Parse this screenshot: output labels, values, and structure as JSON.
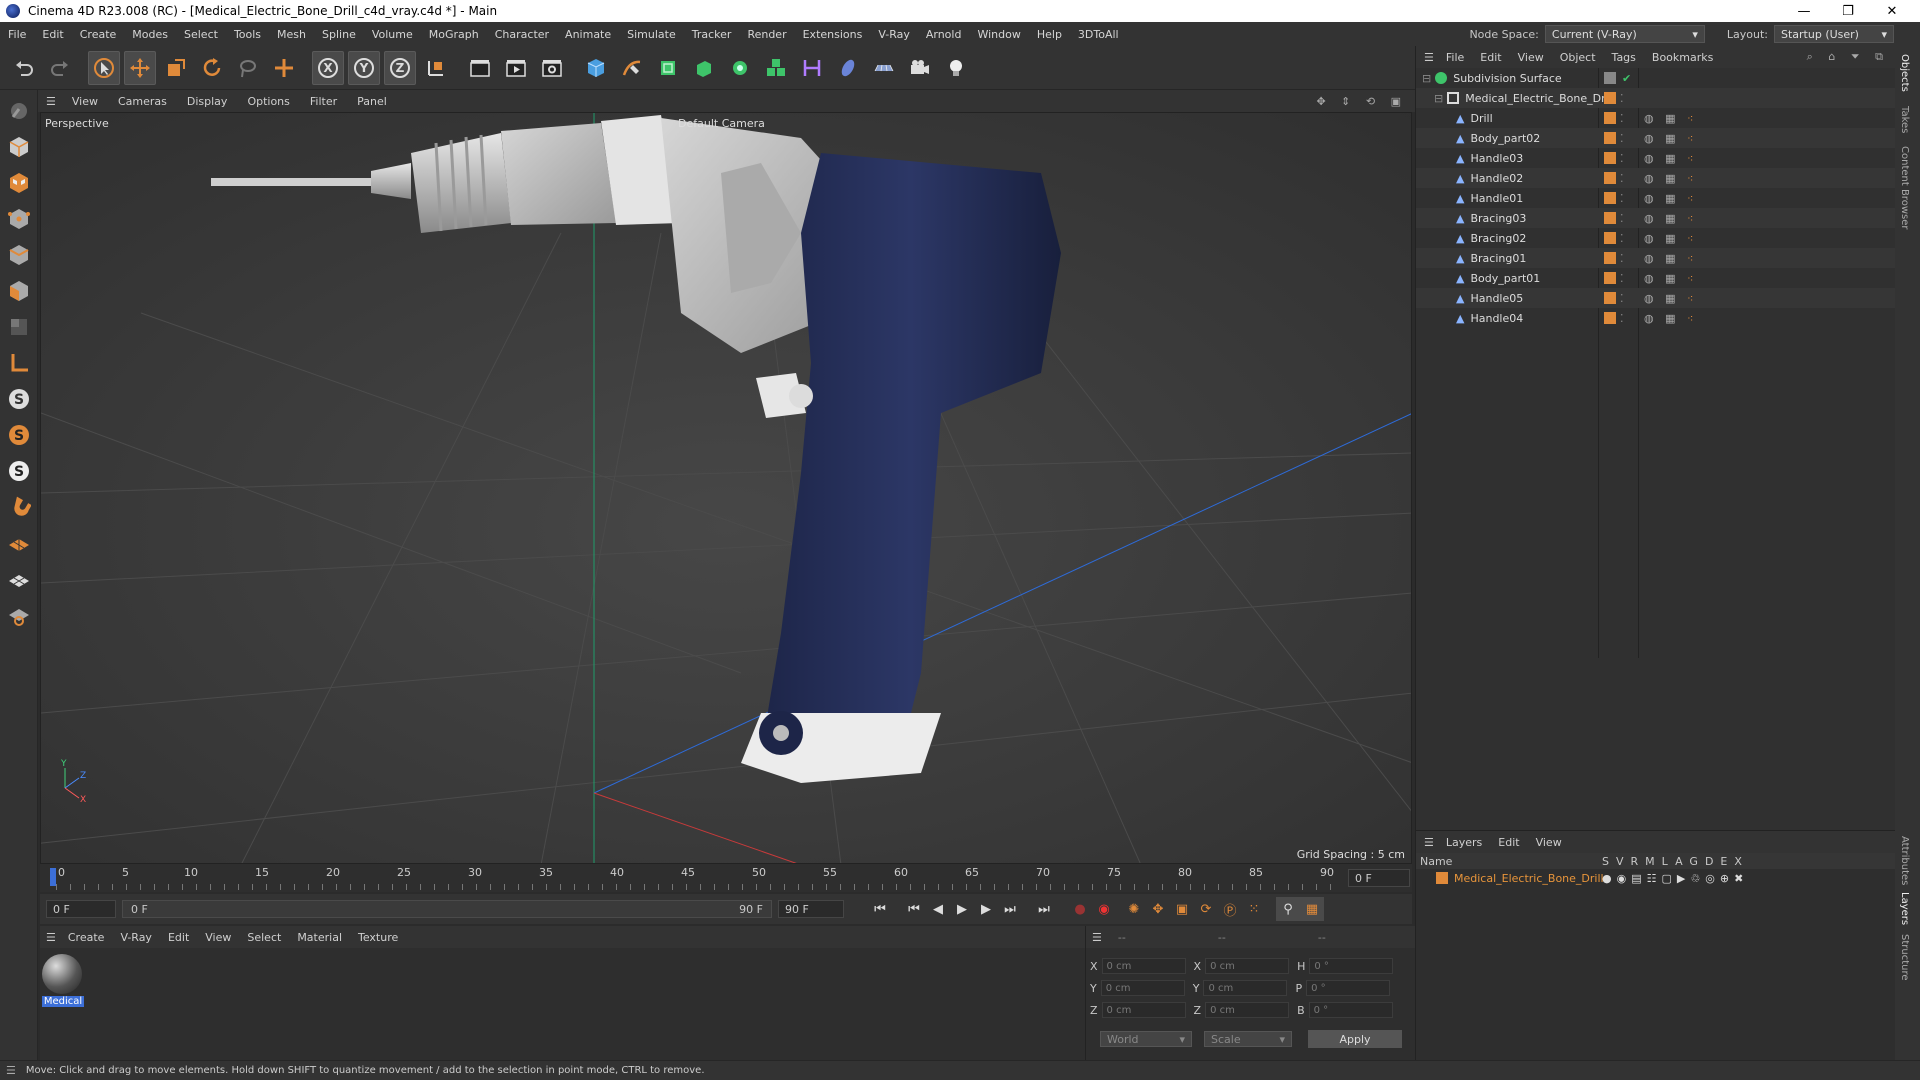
{
  "window": {
    "title": "Cinema 4D R23.008 (RC) - [Medical_Electric_Bone_Drill_c4d_vray.c4d *] - Main",
    "minimize": "—",
    "maximize": "❐",
    "close": "✕"
  },
  "menu": [
    "File",
    "Edit",
    "Create",
    "Modes",
    "Select",
    "Tools",
    "Mesh",
    "Spline",
    "Volume",
    "MoGraph",
    "Character",
    "Animate",
    "Simulate",
    "Tracker",
    "Render",
    "Extensions",
    "V-Ray",
    "Arnold",
    "Window",
    "Help",
    "3DToAll"
  ],
  "nodespace": {
    "label": "Node Space:",
    "value": "Current (V-Ray)"
  },
  "layout": {
    "label": "Layout:",
    "value": "Startup (User)"
  },
  "viewport_menu": [
    "View",
    "Cameras",
    "Display",
    "Options",
    "Filter",
    "Panel"
  ],
  "viewport": {
    "name": "Perspective",
    "camera": "Default Camera",
    "grid": "Grid Spacing : 5 cm"
  },
  "timeline": {
    "ticks": [
      "0",
      "5",
      "10",
      "15",
      "20",
      "25",
      "30",
      "35",
      "40",
      "45",
      "50",
      "55",
      "60",
      "65",
      "70",
      "75",
      "80",
      "85",
      "90"
    ],
    "end_field": "0 F"
  },
  "timectl": {
    "start": "0 F",
    "range_start": "0 F",
    "range_end": "90 F",
    "end": "90 F"
  },
  "mat_menu": [
    "Create",
    "V-Ray",
    "Edit",
    "View",
    "Select",
    "Material",
    "Texture"
  ],
  "material": {
    "name": "Medical"
  },
  "coords": {
    "header": [
      "--",
      "--",
      "--"
    ],
    "rows": [
      {
        "a": "X",
        "av": "0 cm",
        "b": "X",
        "bv": "0 cm",
        "c": "H",
        "cv": "0 °"
      },
      {
        "a": "Y",
        "av": "0 cm",
        "b": "Y",
        "bv": "0 cm",
        "c": "P",
        "cv": "0 °"
      },
      {
        "a": "Z",
        "av": "0 cm",
        "b": "Z",
        "bv": "0 cm",
        "c": "B",
        "cv": "0 °"
      }
    ],
    "world": "World",
    "scale": "Scale",
    "apply": "Apply"
  },
  "status": "Move: Click and drag to move elements. Hold down SHIFT to quantize movement / add to the selection in point mode, CTRL to remove.",
  "obj_menu": [
    "File",
    "Edit",
    "View",
    "Object",
    "Tags",
    "Bookmarks"
  ],
  "objects": [
    {
      "name": "Subdivision Surface"
    },
    {
      "name": "Medical_Electric_Bone_Drill"
    },
    {
      "name": "Drill"
    },
    {
      "name": "Body_part02"
    },
    {
      "name": "Handle03"
    },
    {
      "name": "Handle02"
    },
    {
      "name": "Handle01"
    },
    {
      "name": "Bracing03"
    },
    {
      "name": "Bracing02"
    },
    {
      "name": "Bracing01"
    },
    {
      "name": "Body_part01"
    },
    {
      "name": "Handle05"
    },
    {
      "name": "Handle04"
    }
  ],
  "layers_menu": [
    "Layers",
    "Edit",
    "View"
  ],
  "layers_header": {
    "name": "Name",
    "cols": [
      "S",
      "V",
      "R",
      "M",
      "L",
      "A",
      "G",
      "D",
      "E",
      "X"
    ]
  },
  "layers": [
    {
      "name": "Medical_Electric_Bone_Drill"
    }
  ],
  "side_tabs": [
    "Objects",
    "Takes",
    "Content Browser",
    "Attributes",
    "Layers",
    "Structure"
  ],
  "colors": {
    "accent": "#e08a3a",
    "layer_text": "#e8953b"
  }
}
